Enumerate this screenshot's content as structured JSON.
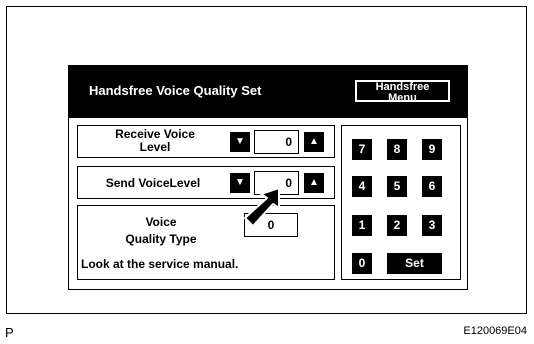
{
  "screen": {
    "title": "Handsfree Voice Quality Set",
    "menu_button": [
      "Handsfree",
      "Menu"
    ]
  },
  "receive": {
    "label_line1": "Receive Voice",
    "label_line2": "Level",
    "down_icon": "triangle-down",
    "up_icon": "triangle-up",
    "value": "0"
  },
  "send": {
    "label": "Send VoiceLevel",
    "down_icon": "triangle-down",
    "up_icon": "triangle-up",
    "value": "0"
  },
  "quality": {
    "label_line1": "Voice",
    "label_line2": "Quality Type",
    "value": "0",
    "note": "Look at the service manual."
  },
  "keypad": [
    "7",
    "8",
    "9",
    "4",
    "5",
    "6",
    "1",
    "2",
    "3",
    "0",
    "Set"
  ],
  "pointer_icon": "pointer-arrow",
  "footer": {
    "left_label": "P",
    "figure_code": "E120069E04"
  }
}
